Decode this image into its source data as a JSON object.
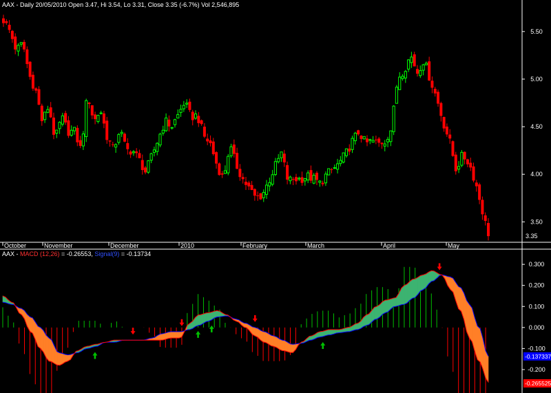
{
  "header": {
    "price_title": "AAX - Daily 20/05/2010 Open 3.47, Hi 3.54, Lo 3.31, Close 3.35 (-6.7%) Vol 2,546,895",
    "macd_prefix": "AAX - ",
    "macd_label": "MACD (12,26)",
    "macd_value": " = -0.26553, ",
    "signal_label": "Signal(9)",
    "signal_value": " = -0.13734"
  },
  "colors": {
    "background": "#000000",
    "axis_line": "#ffffff",
    "candle_up": "#00ff00",
    "candle_down": "#ff0000",
    "hist_up": "#00c000",
    "hist_down": "#ff0000",
    "macd_line": "#ff0000",
    "signal_line": "#0000ff",
    "fill_bull": "#3cb371",
    "fill_bear": "#ff7f27",
    "arrow_up": "#00c000",
    "arrow_down": "#ff0000",
    "signal_tag_bg": "#0000ff",
    "macd_tag_bg": "#ff0000"
  },
  "chart_data": [
    {
      "type": "candlestick",
      "title": "AAX - Daily 20/05/2010 Open 3.47, Hi 3.54, Lo 3.31, Close 3.35 (-6.7%) Vol 2,546,895",
      "x_labels": [
        "October",
        "November",
        "December",
        "2010",
        "February",
        "March",
        "April",
        "May"
      ],
      "y_ticks": [
        5.5,
        5.0,
        4.5,
        4.0,
        3.5
      ],
      "ylim": [
        3.3,
        5.73
      ],
      "last_close": 3.35,
      "last_close_label": "3.35",
      "anchors": [
        5.62,
        5.5,
        5.3,
        5.38,
        5.04,
        4.88,
        4.55,
        4.72,
        4.36,
        4.6,
        4.45,
        4.45,
        4.25,
        4.85,
        4.55,
        4.68,
        4.4,
        4.25,
        4.48,
        4.25,
        4.25,
        4.15,
        4.02,
        4.2,
        4.38,
        4.56,
        4.5,
        4.62,
        4.76,
        4.6,
        4.62,
        4.4,
        4.32,
        4.1,
        3.95,
        4.3,
        4.1,
        3.95,
        3.85,
        3.75,
        3.78,
        3.92,
        4.08,
        4.22,
        3.93,
        3.95,
        3.95,
        3.98,
        3.95,
        3.9,
        4.0,
        4.05,
        4.12,
        4.22,
        4.35,
        4.45,
        4.32,
        4.35,
        4.32,
        4.35,
        4.48,
        5.02,
        5.1,
        5.25,
        5.07,
        5.2,
        5.0,
        4.8,
        4.55,
        4.35,
        4.05,
        4.2,
        4.12,
        3.92,
        3.64,
        3.35
      ]
    },
    {
      "type": "macd",
      "macd_name": "MACD (12,26)",
      "signal_name": "Signal(9)",
      "macd_last": -0.26553,
      "signal_last": -0.13734,
      "y_ticks": [
        0.3,
        0.2,
        0.1,
        0.0,
        -0.1,
        -0.2
      ],
      "ylim": [
        -0.295,
        0.32
      ],
      "signal_tag": "-0.137337",
      "macd_tag": "-0.265525",
      "macd": [
        0.15,
        0.12,
        0.06,
        -0.02,
        -0.1,
        -0.16,
        -0.18,
        -0.16,
        -0.11,
        -0.09,
        -0.08,
        -0.07,
        -0.06,
        -0.06,
        -0.06,
        -0.06,
        -0.06,
        -0.06,
        -0.05,
        -0.05,
        0.02,
        0.06,
        0.07,
        0.08,
        0.06,
        0.03,
        0.0,
        -0.04,
        -0.07,
        -0.09,
        -0.11,
        -0.12,
        -0.07,
        -0.04,
        -0.02,
        -0.01,
        -0.01,
        0.0,
        0.02,
        0.06,
        0.1,
        0.13,
        0.14,
        0.2,
        0.23,
        0.25,
        0.27,
        0.25,
        0.18,
        0.08,
        -0.05,
        -0.16,
        -0.26
      ],
      "signal": [
        0.12,
        0.11,
        0.09,
        0.05,
        0.0,
        -0.05,
        -0.12,
        -0.13,
        -0.12,
        -0.1,
        -0.09,
        -0.07,
        -0.07,
        -0.06,
        -0.06,
        -0.06,
        -0.05,
        -0.03,
        -0.02,
        -0.02,
        -0.01,
        0.01,
        0.03,
        0.05,
        0.055,
        0.04,
        0.02,
        0.0,
        -0.02,
        -0.04,
        -0.06,
        -0.08,
        -0.075,
        -0.06,
        -0.045,
        -0.035,
        -0.025,
        -0.02,
        -0.01,
        0.01,
        0.04,
        0.07,
        0.1,
        0.11,
        0.14,
        0.18,
        0.22,
        0.25,
        0.24,
        0.19,
        0.11,
        0.0,
        -0.137
      ],
      "buy_arrows": [
        0.19,
        0.4,
        0.43,
        0.66
      ],
      "sell_arrows": [
        0.27,
        0.37,
        0.52,
        0.9
      ]
    }
  ]
}
